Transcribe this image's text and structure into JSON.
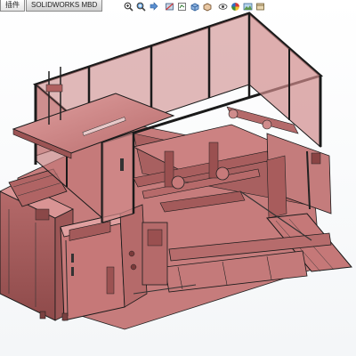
{
  "tabs": [
    {
      "label": "插件",
      "active": true
    },
    {
      "label": "SOLIDWORKS MBD",
      "active": false
    }
  ],
  "heads_up_toolbar": [
    {
      "name": "zoom-to-fit-icon"
    },
    {
      "name": "zoom-to-area-icon"
    },
    {
      "name": "previous-view-icon"
    },
    {
      "name": "section-view-icon"
    },
    {
      "name": "dynamic-annotation-icon"
    },
    {
      "name": "view-orientation-icon"
    },
    {
      "name": "display-style-icon"
    },
    {
      "name": "hide-show-items-icon"
    },
    {
      "name": "edit-appearance-icon"
    },
    {
      "name": "apply-scene-icon"
    },
    {
      "name": "view-settings-icon"
    }
  ],
  "colors": {
    "part_fill": "#d08484",
    "part_fill_light": "#e2a2a2",
    "part_fill_dark": "#a45a5a",
    "edge": "#1a1a1a",
    "frame": "#2a2a2a",
    "background": "#ffffff"
  }
}
